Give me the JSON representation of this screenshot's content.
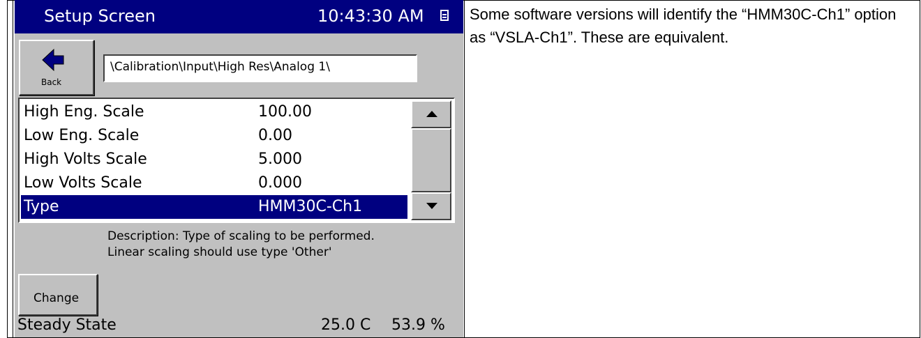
{
  "titlebar": {
    "title": "Setup Screen",
    "clock": "10:43:30 AM",
    "icon": "keyboard-icon"
  },
  "back_button": {
    "label": "Back",
    "icon": "back-arrow-icon"
  },
  "path": "\\Calibration\\Input\\High Res\\Analog 1\\",
  "settings": [
    {
      "name": "High Eng. Scale",
      "value": "100.00"
    },
    {
      "name": "Low Eng. Scale",
      "value": "0.00"
    },
    {
      "name": "High Volts Scale",
      "value": "5.000"
    },
    {
      "name": "Low Volts Scale",
      "value": "0.000"
    },
    {
      "name": "Type",
      "value": "HMM30C-Ch1",
      "selected": true
    }
  ],
  "description": {
    "line1": "Description:  Type of scaling to be performed.",
    "line2": "Linear scaling should use type 'Other'"
  },
  "change_button": {
    "label": "Change"
  },
  "status": {
    "state": "Steady State",
    "temperature": "25.0 C",
    "humidity": "53.9 %"
  },
  "note": "Some software versions will identify the “HMM30C-Ch1” option as “VSLA-Ch1”. These are equivalent.",
  "colors": {
    "titlebar": "#000080",
    "panel": "#c0c0c0",
    "selection": "#000080"
  }
}
